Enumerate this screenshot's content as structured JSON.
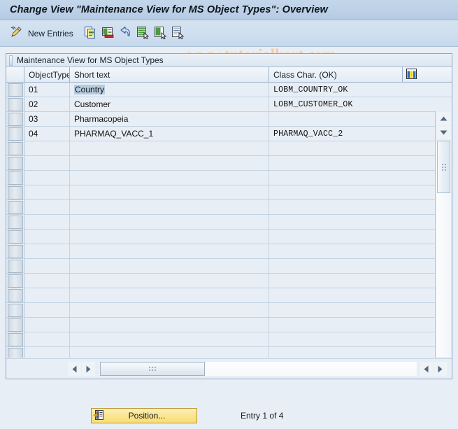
{
  "window": {
    "title": "Change View \"Maintenance View for MS Object Types\": Overview"
  },
  "toolbar": {
    "edit_icon": "pencil-icon",
    "new_entries_label": "New Entries",
    "buttons": [
      {
        "name": "copy-as-button",
        "icon": "copy-icon"
      },
      {
        "name": "delete-button",
        "icon": "delete-icon"
      },
      {
        "name": "undo-button",
        "icon": "undo-icon"
      },
      {
        "name": "select-all-button",
        "icon": "select-all-icon"
      },
      {
        "name": "deselect-all-button",
        "icon": "deselect-all-icon"
      },
      {
        "name": "select-block-button",
        "icon": "select-block-icon"
      }
    ]
  },
  "watermark": {
    "text": "www.tutorialkart.com",
    "color": "#f2c9a4"
  },
  "grid": {
    "caption": "Maintenance View for MS Object Types",
    "columns": [
      "ObjectType",
      "Short text",
      "Class Char. (OK)"
    ],
    "config_icon": "column-config-icon",
    "rows": [
      {
        "object_type": "01",
        "short_text": "Country",
        "class_char": "LOBM_COUNTRY_OK",
        "selected": true
      },
      {
        "object_type": "02",
        "short_text": "Customer",
        "class_char": "LOBM_CUSTOMER_OK",
        "selected": false
      },
      {
        "object_type": "03",
        "short_text": "Pharmacopeia",
        "class_char": "",
        "selected": false
      },
      {
        "object_type": "04",
        "short_text": "PHARMAQ_VACC_1",
        "class_char": "PHARMAQ_VACC_2",
        "selected": false
      }
    ],
    "empty_row_count": 15,
    "scroll": {
      "up_icon": "scroll-up-icon",
      "down_icon": "scroll-down-icon",
      "left_icon": "scroll-left-icon",
      "right_icon": "scroll-right-icon"
    }
  },
  "footer": {
    "position_label": "Position...",
    "position_icon": "position-icon",
    "entry_status": "Entry 1 of 4"
  }
}
